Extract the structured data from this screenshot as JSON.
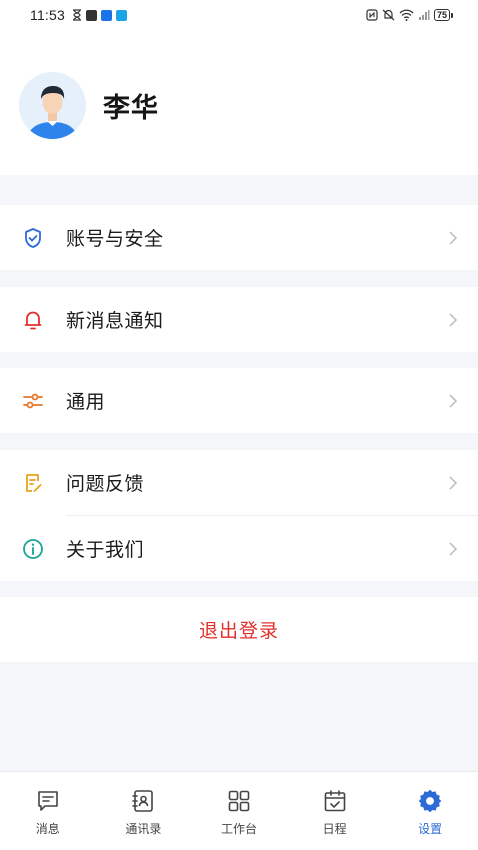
{
  "status_bar": {
    "time": "11:53",
    "battery": "75"
  },
  "profile": {
    "name": "李华"
  },
  "menu": {
    "account_security": "账号与安全",
    "notifications": "新消息通知",
    "general": "通用",
    "feedback": "问题反馈",
    "about": "关于我们"
  },
  "logout": {
    "label": "退出登录"
  },
  "tabs": {
    "messages": "消息",
    "contacts": "通讯录",
    "workbench": "工作台",
    "schedule": "日程",
    "settings": "设置"
  },
  "colors": {
    "accent": "#2c6bd6",
    "danger": "#e0302c",
    "background": "#f4f6f9"
  }
}
